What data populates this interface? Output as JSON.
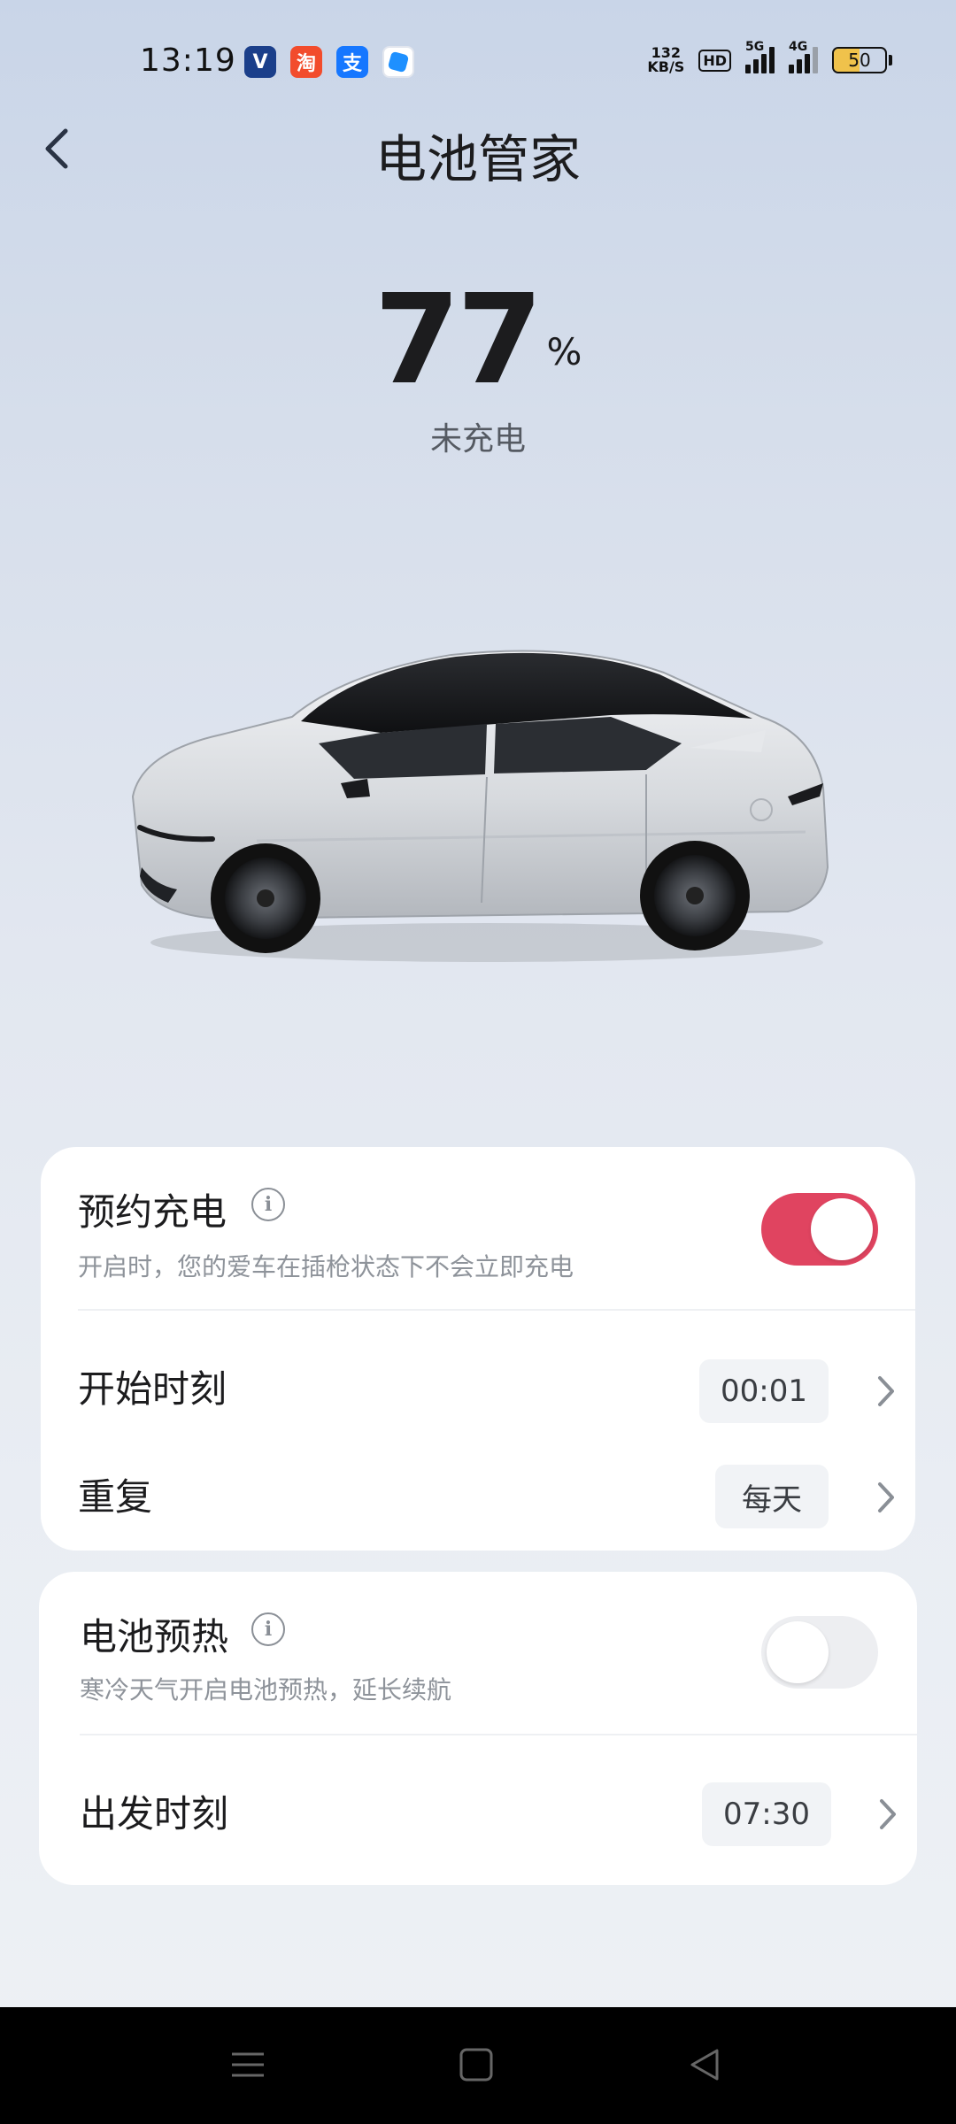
{
  "status_bar": {
    "time": "13:19",
    "net_speed_value": "132",
    "net_speed_unit": "KB/S",
    "hd_label": "HD",
    "sim1_label": "5G",
    "sim2_label": "4G",
    "battery_level": "50",
    "battery_fill_percent": 50,
    "app_icons": [
      "changan-app-icon",
      "taobao-app-icon",
      "alipay-app-icon",
      "blue-app-icon"
    ],
    "app_icon_glyphs": {
      "changan": "V",
      "taobao": "淘",
      "alipay": "支"
    }
  },
  "header": {
    "title": "电池管家",
    "back_icon": "chevron-left-icon"
  },
  "battery": {
    "percent": "77",
    "percent_sign": "%",
    "status": "未充电"
  },
  "scheduled_charging": {
    "title": "预约充电",
    "description": "开启时，您的爱车在插枪状态下不会立即充电",
    "enabled": true,
    "start_time_label": "开始时刻",
    "start_time_value": "00:01",
    "repeat_label": "重复",
    "repeat_value": "每天"
  },
  "battery_preheat": {
    "title": "电池预热",
    "description": "寒冷天气开启电池预热，延长续航",
    "enabled": false,
    "departure_label": "出发时刻",
    "departure_value": "07:30"
  },
  "colors": {
    "toggle_on": "#e04460",
    "toggle_off": "#edeef1",
    "title_text": "#1c1c1e",
    "secondary_text": "#8e939a"
  },
  "nav_bar": {
    "buttons": [
      "menu-icon",
      "home-square-icon",
      "back-triangle-icon"
    ]
  }
}
